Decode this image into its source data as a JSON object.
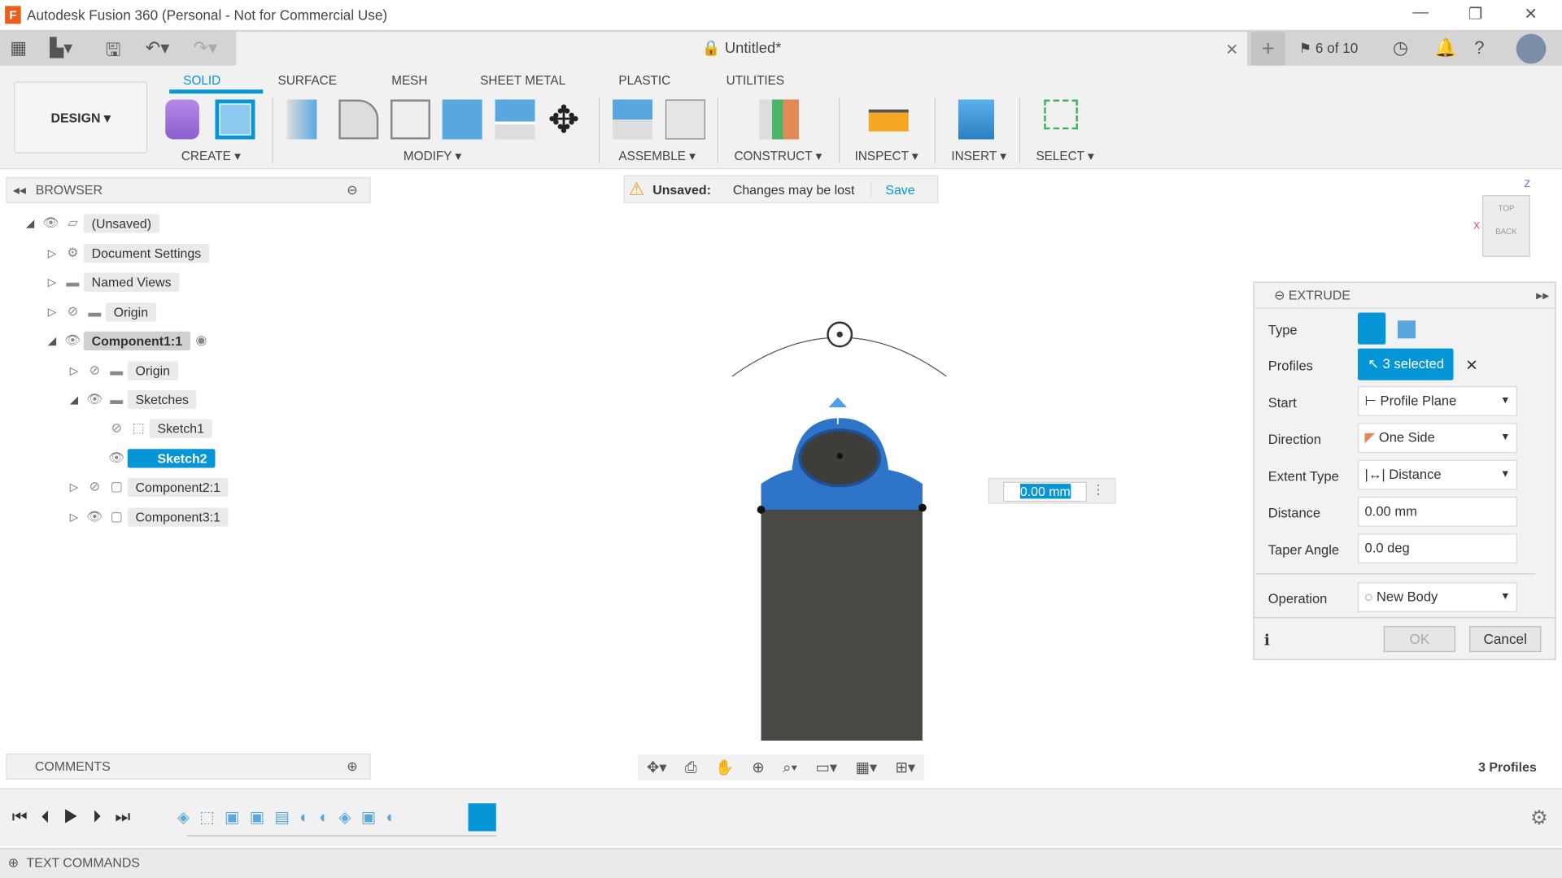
{
  "title": "Autodesk Fusion 360 (Personal - Not for Commercial Use)",
  "doc_tab": {
    "title": "Untitled*"
  },
  "top_right": {
    "jobs": "6 of 10"
  },
  "workspace": "DESIGN",
  "ribbon_tabs": [
    "SOLID",
    "SURFACE",
    "MESH",
    "SHEET METAL",
    "PLASTIC",
    "UTILITIES"
  ],
  "groups": [
    "CREATE",
    "MODIFY",
    "ASSEMBLE",
    "CONSTRUCT",
    "INSPECT",
    "INSERT",
    "SELECT"
  ],
  "browser": {
    "title": "BROWSER",
    "items": [
      "(Unsaved)",
      "Document Settings",
      "Named Views",
      "Origin",
      "Component1:1",
      "Origin",
      "Sketches",
      "Sketch1",
      "Sketch2",
      "Component2:1",
      "Component3:1"
    ]
  },
  "banner": {
    "label": "Unsaved:",
    "message": "Changes may be lost",
    "save": "Save"
  },
  "viewcube": {
    "top": "TOP",
    "back": "BACK",
    "z": "Z",
    "x": "X"
  },
  "distance_input": "0.00 mm",
  "extrude": {
    "title": "EXTRUDE",
    "labels": {
      "type": "Type",
      "profiles": "Profiles",
      "start": "Start",
      "direction": "Direction",
      "extent": "Extent Type",
      "distance": "Distance",
      "taper": "Taper Angle",
      "operation": "Operation"
    },
    "profiles": "3 selected",
    "start": "Profile Plane",
    "direction": "One Side",
    "extent": "Distance",
    "distance": "0.00 mm",
    "taper": "0.0 deg",
    "operation": "New Body",
    "ok": "OK",
    "cancel": "Cancel"
  },
  "comments": "COMMENTS",
  "status": "3 Profiles",
  "text_commands": "TEXT COMMANDS"
}
